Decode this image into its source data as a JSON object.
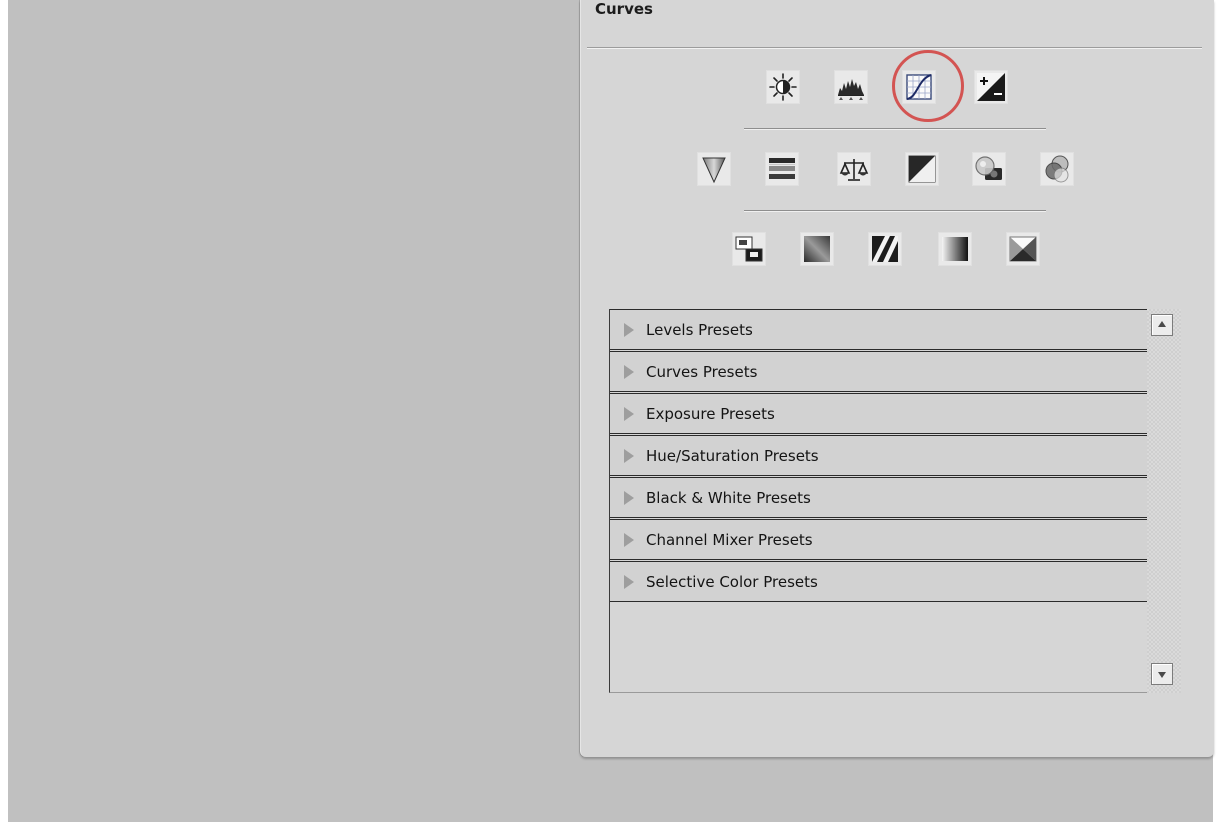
{
  "panel": {
    "title": "Curves"
  },
  "adjustments": {
    "row1": [
      {
        "icon": "brightness-contrast-icon"
      },
      {
        "icon": "levels-icon"
      },
      {
        "icon": "curves-icon",
        "highlighted": true
      },
      {
        "icon": "exposure-icon"
      }
    ],
    "row2": [
      {
        "icon": "vibrance-icon"
      },
      {
        "icon": "hue-saturation-icon"
      },
      {
        "icon": "color-balance-icon"
      },
      {
        "icon": "black-white-icon"
      },
      {
        "icon": "photo-filter-icon"
      },
      {
        "icon": "channel-mixer-icon"
      }
    ],
    "row3": [
      {
        "icon": "invert-icon"
      },
      {
        "icon": "posterize-icon"
      },
      {
        "icon": "threshold-icon"
      },
      {
        "icon": "gradient-map-icon"
      },
      {
        "icon": "selective-color-icon"
      }
    ],
    "highlight_color": "#d35452"
  },
  "presets": {
    "items": [
      {
        "label": "Levels Presets"
      },
      {
        "label": "Curves Presets"
      },
      {
        "label": "Exposure Presets"
      },
      {
        "label": "Hue/Saturation Presets"
      },
      {
        "label": "Black & White Presets"
      },
      {
        "label": "Channel Mixer Presets"
      },
      {
        "label": "Selective Color Presets"
      }
    ]
  }
}
